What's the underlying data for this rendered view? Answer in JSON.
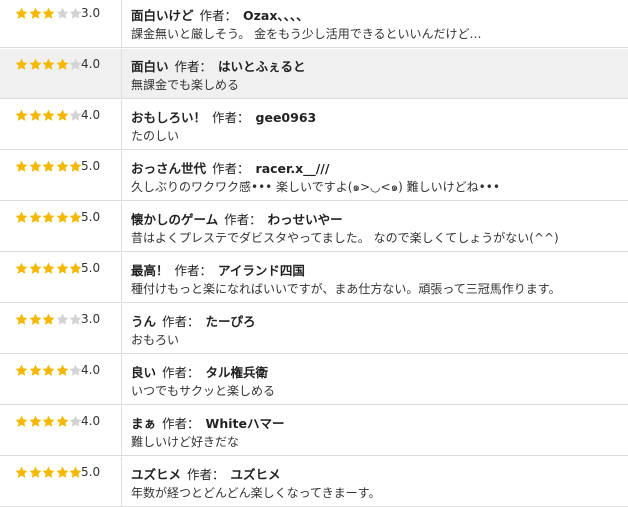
{
  "colors": {
    "star_filled": "#f5b800",
    "star_empty": "#d3d3d3",
    "row_shade": "#f0f0f0",
    "divider": "#dcdcdc"
  },
  "author_prefix": "作者：",
  "reviews": [
    {
      "rating": 3,
      "score": "3.0",
      "title": "面白いけど",
      "author": "Ozax、、、、",
      "body": "課金無いと厳しそう。 金をもう少し活用できるといいんだけど…"
    },
    {
      "rating": 4,
      "score": "4.0",
      "title": "面白い",
      "author": "はいとふぇると",
      "body": "無課金でも楽しめる"
    },
    {
      "rating": 4,
      "score": "4.0",
      "title": "おもしろい！",
      "author": "gee0963",
      "body": "たのしい"
    },
    {
      "rating": 5,
      "score": "5.0",
      "title": "おっさん世代",
      "author": "racer.x__///",
      "body": "久しぶりのワクワク感••• 楽しいですよ(๑>◡<๑) 難しいけどね•••"
    },
    {
      "rating": 5,
      "score": "5.0",
      "title": "懐かしのゲーム",
      "author": "わっせいやー",
      "body": "昔はよくプレステでダビスタやってました。 なので楽しくてしょうがない(^^)"
    },
    {
      "rating": 5,
      "score": "5.0",
      "title": "最高！",
      "author": "アイランド四国",
      "body": "種付けもっと楽になればいいですが、まあ仕方ない。頑張って三冠馬作ります。"
    },
    {
      "rating": 3,
      "score": "3.0",
      "title": "うん",
      "author": "たーぴろ",
      "body": "おもろい"
    },
    {
      "rating": 4,
      "score": "4.0",
      "title": "良い",
      "author": "タル権兵衛",
      "body": "いつでもサクッと楽しめる"
    },
    {
      "rating": 4,
      "score": "4.0",
      "title": "まぁ",
      "author": "Whiteハマー",
      "body": "難しいけど好きだな"
    },
    {
      "rating": 5,
      "score": "5.0",
      "title": "ユズヒメ",
      "author": "ユズヒメ",
      "body": "年数が経つとどんどん楽しくなってきまーす。"
    }
  ]
}
